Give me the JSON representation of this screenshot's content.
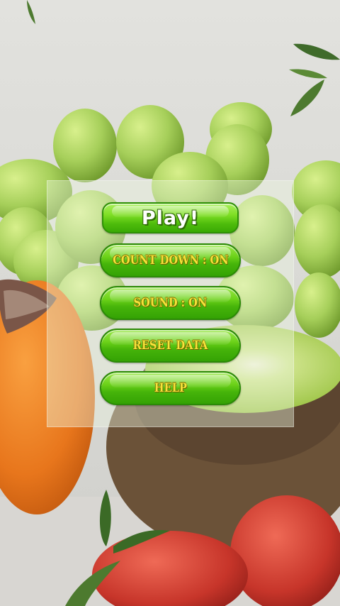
{
  "menu": {
    "play_label": "Play!",
    "countdown_label": "COUNT DOWN : ON",
    "sound_label": "SOUND : ON",
    "reset_label": "RESET DATA",
    "help_label": "HELP"
  },
  "background": {
    "scene": "fruit-still-life",
    "colors": {
      "wall": "#dcdcd8",
      "grape": "#a6cf5a",
      "orange": "#e8761c",
      "kiwi_skin": "#6b5238",
      "kiwi_flesh": "#b6d85a",
      "strawberry": "#c7352a",
      "leaf": "#4d7a2f"
    }
  },
  "accent": {
    "button_green": "#5cc612",
    "label_yellow": "#f4e43a"
  }
}
